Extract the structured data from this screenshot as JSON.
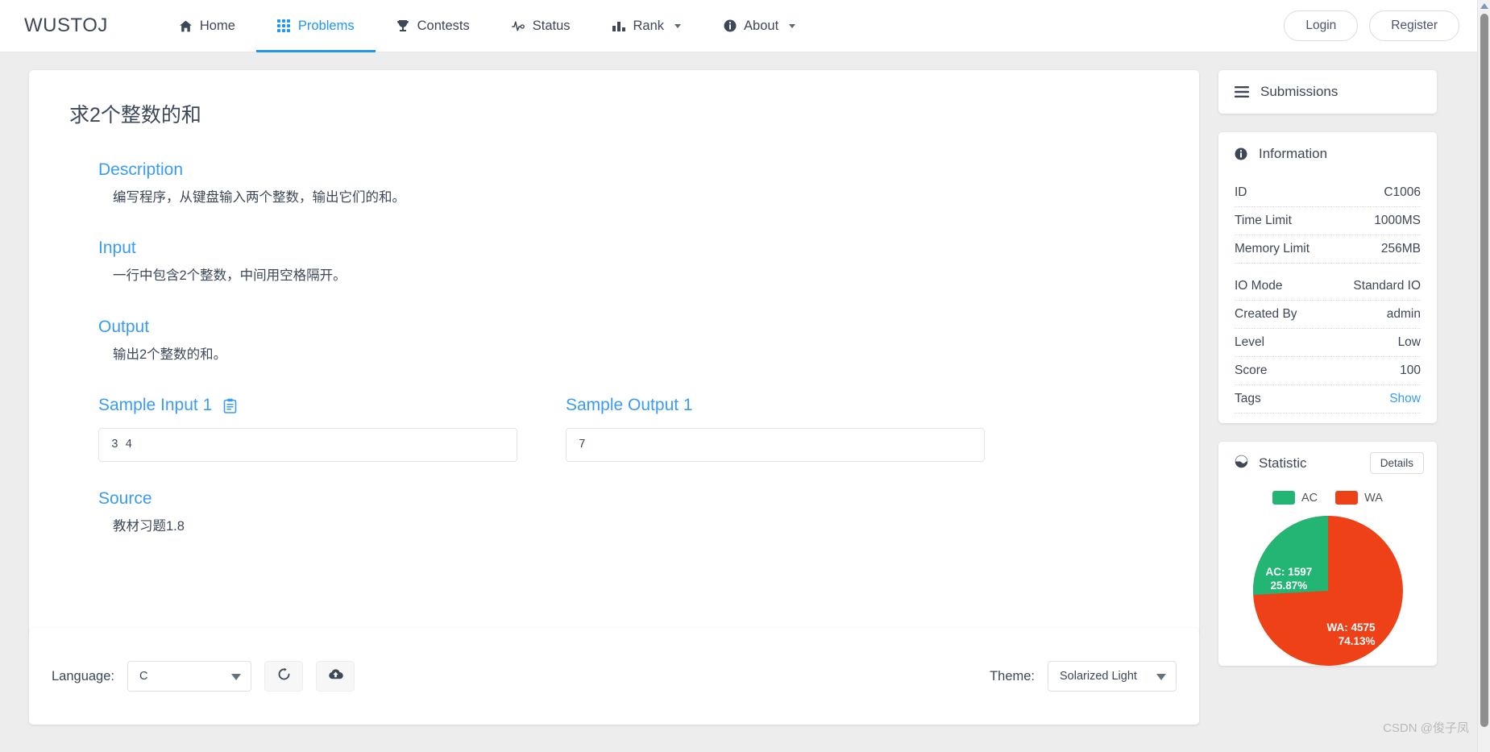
{
  "navbar": {
    "brand": "WUSTOJ",
    "items": [
      {
        "label": "Home",
        "icon": "home-icon",
        "active": false,
        "caret": false
      },
      {
        "label": "Problems",
        "icon": "grid-icon",
        "active": true,
        "caret": false
      },
      {
        "label": "Contests",
        "icon": "trophy-icon",
        "active": false,
        "caret": false
      },
      {
        "label": "Status",
        "icon": "activity-icon",
        "active": false,
        "caret": false
      },
      {
        "label": "Rank",
        "icon": "bars-icon",
        "active": false,
        "caret": true
      },
      {
        "label": "About",
        "icon": "info-icon",
        "active": false,
        "caret": true
      }
    ],
    "login_label": "Login",
    "register_label": "Register",
    "accent_color": "#2196f3"
  },
  "problem": {
    "title": "求2个整数的和",
    "sections": {
      "description_head": "Description",
      "description_body": "编写程序，从键盘输入两个整数，输出它们的和。",
      "input_head": "Input",
      "input_body": "一行中包含2个整数，中间用空格隔开。",
      "output_head": "Output",
      "output_body": "输出2个整数的和。",
      "sample_input_head": "Sample Input 1",
      "sample_input_value": "3 4",
      "sample_output_head": "Sample Output 1",
      "sample_output_value": "7",
      "source_head": "Source",
      "source_body": "教材习题1.8"
    }
  },
  "sidebar": {
    "submissions": {
      "title": "Submissions",
      "icon": "list-icon"
    },
    "information": {
      "title": "Information",
      "icon": "info-circle-icon",
      "rows": [
        {
          "label": "ID",
          "value": "C1006",
          "link": false
        },
        {
          "label": "Time Limit",
          "value": "1000MS",
          "link": false
        },
        {
          "label": "Memory Limit",
          "value": "256MB",
          "link": false
        },
        {
          "label": "IO Mode",
          "value": "Standard IO",
          "link": false
        },
        {
          "label": "Created By",
          "value": "admin",
          "link": false
        },
        {
          "label": "Level",
          "value": "Low",
          "link": false
        },
        {
          "label": "Score",
          "value": "100",
          "link": false
        },
        {
          "label": "Tags",
          "value": "Show",
          "link": true
        }
      ]
    },
    "statistic": {
      "title": "Statistic",
      "icon": "chart-pie-icon",
      "details_label": "Details"
    }
  },
  "chart_data": {
    "type": "pie",
    "title": "Statistic",
    "categories": [
      "AC",
      "WA"
    ],
    "values": [
      1597,
      4575
    ],
    "percents": [
      25.87,
      74.13
    ],
    "colors": [
      "#22b573",
      "#ef4118"
    ],
    "labels": [
      "AC: 1597\n25.87%",
      "WA: 4575\n74.13%"
    ],
    "legend": [
      "AC",
      "WA"
    ],
    "legend_position": "top"
  },
  "editor_bar": {
    "language_label": "Language:",
    "language_value": "C",
    "reset_icon": "refresh-icon",
    "upload_icon": "cloud-upload-icon",
    "theme_label": "Theme:",
    "theme_value": "Solarized Light"
  },
  "watermark": "CSDN @俊子凤"
}
